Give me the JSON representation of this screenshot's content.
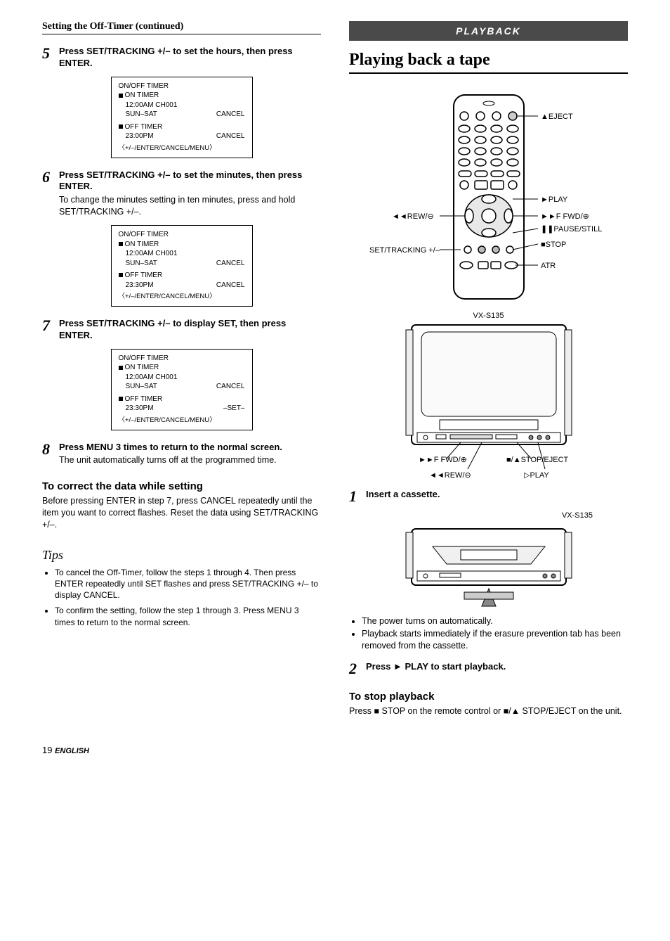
{
  "left": {
    "section_header": "Setting the Off-Timer (continued)",
    "step5": {
      "num": "5",
      "title": "Press SET/TRACKING +/– to set the hours, then press ENTER.",
      "screen": {
        "l1": "ON/OFF TIMER",
        "l2": "ON TIMER",
        "l3": "12:00AM   CH001",
        "l4_left": "SUN–SAT",
        "l4_right": "CANCEL",
        "l5": "OFF TIMER",
        "l6_left": "23:00PM",
        "l6_right": "CANCEL",
        "footer": "〈+/–/ENTER/CANCEL/MENU〉"
      }
    },
    "step6": {
      "num": "6",
      "title": "Press SET/TRACKING +/– to set the minutes, then press ENTER.",
      "desc": "To change the minutes setting in ten minutes, press and hold SET/TRACKING +/–.",
      "screen": {
        "l1": "ON/OFF TIMER",
        "l2": "ON TIMER",
        "l3": "12:00AM   CH001",
        "l4_left": "SUN–SAT",
        "l4_right": "CANCEL",
        "l5": "OFF TIMER",
        "l6_left": "23:30PM",
        "l6_right": "CANCEL",
        "footer": "〈+/–/ENTER/CANCEL/MENU〉"
      }
    },
    "step7": {
      "num": "7",
      "title": "Press SET/TRACKING +/– to display SET, then press ENTER.",
      "screen": {
        "l1": "ON/OFF TIMER",
        "l2": "ON TIMER",
        "l3": "12:00AM   CH001",
        "l4_left": "SUN–SAT",
        "l4_right": "CANCEL",
        "l5": "OFF TIMER",
        "l6_left": "23:30PM",
        "l6_right": "–SET–",
        "footer": "〈+/–/ENTER/CANCEL/MENU〉"
      }
    },
    "step8": {
      "num": "8",
      "title": "Press MENU 3 times to return to the normal screen.",
      "desc": "The unit automatically turns off at the programmed time."
    },
    "correct": {
      "heading": "To correct the data while setting",
      "body": "Before pressing ENTER in step 7, press CANCEL repeatedly until the item you want to correct flashes. Reset the data using SET/TRACKING +/–."
    },
    "tips_header": "Tips",
    "tips": [
      "To cancel the Off-Timer, follow the steps 1 through 4. Then press ENTER repeatedly until SET flashes and press SET/TRACKING +/– to display CANCEL.",
      "To confirm the setting, follow the step 1 through 3. Press MENU 3 times to return to the normal screen."
    ]
  },
  "right": {
    "banner": "PLAYBACK",
    "title": "Playing back a tape",
    "remote_labels": {
      "eject": "▲EJECT",
      "play": "►PLAY",
      "ffwd": "►►F FWD/⊕",
      "pause": "❚❚PAUSE/STILL",
      "stop": "■STOP",
      "atr": "ATR",
      "rew": "◄◄REW/⊖",
      "settracking": "SET/TRACKING +/–"
    },
    "model": "VX-S135",
    "tv_labels": {
      "ffwd": "►►F FWD/⊕",
      "stopeject": "■/▲STOP/EJECT",
      "rew": "◄◄REW/⊖",
      "play": "▷PLAY"
    },
    "step1": {
      "num": "1",
      "title": "Insert a cassette.",
      "model": "VX-S135",
      "bullets": [
        "The power turns on automatically.",
        "Playback starts immediately if the erasure prevention tab has been removed from the cassette."
      ]
    },
    "step2": {
      "num": "2",
      "title": "Press ► PLAY to start playback."
    },
    "stop": {
      "heading": "To stop playback",
      "body": "Press ■ STOP on the remote control or ■/▲ STOP/EJECT on the unit."
    }
  },
  "page_number": "19",
  "page_lang": "ENGLISH"
}
